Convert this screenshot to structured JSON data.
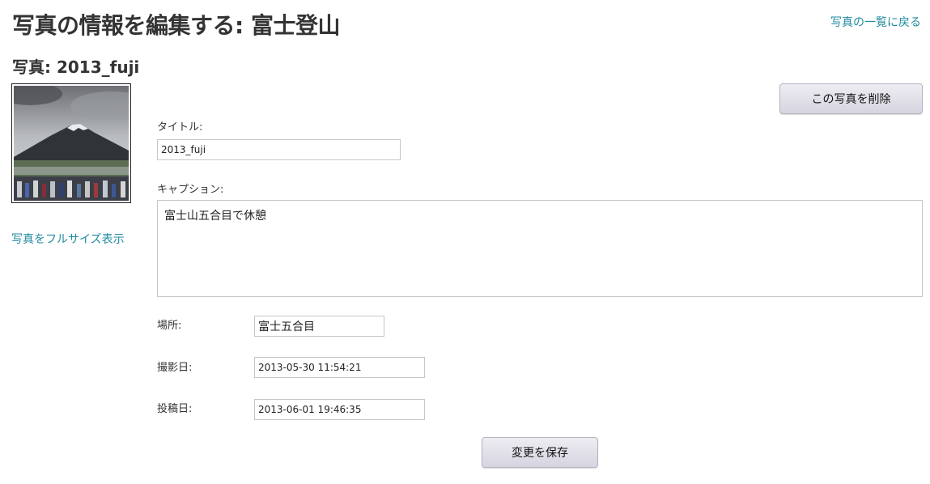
{
  "header": {
    "title": "写真の情報を編集する: 富士登山",
    "back_link": "写真の一覧に戻る"
  },
  "photo": {
    "heading": "写真: 2013_fuji",
    "thumbnail_alt": "2013_fuji",
    "fullsize_link": "写真をフルサイズ表示"
  },
  "actions": {
    "delete_label": "この写真を削除",
    "save_label": "変更を保存"
  },
  "form": {
    "title_label": "タイトル:",
    "title_value": "2013_fuji",
    "caption_label": "キャプション:",
    "caption_value": "富士山五合目で休憩",
    "location_label": "場所:",
    "location_value": "富士五合目",
    "taken_label": "撮影日:",
    "taken_value": "2013-05-30 11:54:21",
    "posted_label": "投稿日:",
    "posted_value": "2013-06-01 19:46:35"
  },
  "colors": {
    "link": "#1f8a9f",
    "text": "#333333",
    "button_bg": "#dddbe5"
  }
}
